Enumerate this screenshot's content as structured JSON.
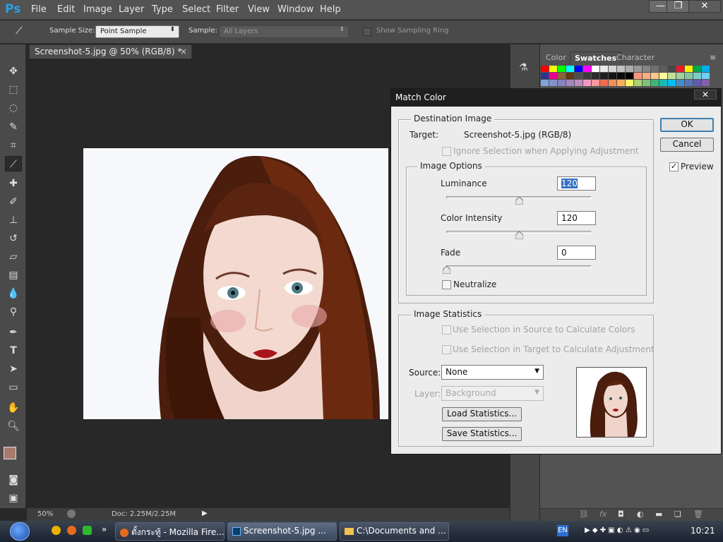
{
  "app": {
    "logo": "Ps",
    "menus": [
      "File",
      "Edit",
      "Image",
      "Layer",
      "Type",
      "Select",
      "Filter",
      "View",
      "Window",
      "Help"
    ],
    "window_controls": {
      "minimize": "—",
      "restore": "❐",
      "close": "✕"
    }
  },
  "options_bar": {
    "sample_size_label": "Sample Size:",
    "sample_size_value": "Point Sample",
    "sample_label": "Sample:",
    "sample_value": "All Layers",
    "show_ring_label": "Show Sampling Ring"
  },
  "document": {
    "tab_title": "Screenshot-5.jpg @ 50% (RGB/8) *",
    "tab_close": "×",
    "zoom": "50%",
    "doc_info": "Doc: 2.25M/2.25M"
  },
  "panels": {
    "tabs": [
      "Color",
      "Swatches",
      "Character"
    ],
    "active_tab": "Swatches",
    "swatch_row1": [
      "#ff0000",
      "#ffff00",
      "#00ff00",
      "#00ffff",
      "#0000ff",
      "#ff00ff",
      "#ffffff",
      "#ebebeb",
      "#d6d6d6",
      "#c2c2c2",
      "#adadad",
      "#999999",
      "#858585",
      "#707070",
      "#5c5c5c",
      "#474747",
      "#ed1c24",
      "#fff200",
      "#00a651",
      "#00aeef"
    ],
    "swatch_row2": [
      "#2e3192",
      "#ec008c",
      "#8c6239",
      "#603813",
      "#4d4d4d",
      "#3b3b3b",
      "#2b2b2b",
      "#1f1f1f",
      "#141414",
      "#0a0a0a",
      "#000000",
      "#f7977a",
      "#f9ad81",
      "#fdc68a",
      "#fff79a",
      "#c4df9b",
      "#a3d39c",
      "#82ca9d",
      "#7bcdc8",
      "#6ecff6"
    ],
    "swatch_row3": [
      "#7ea7d8",
      "#8493ca",
      "#8882be",
      "#a187be",
      "#bc8dbf",
      "#f49ac2",
      "#f6989d",
      "#f26c4f",
      "#f68e55",
      "#fbaf5c",
      "#fff467",
      "#acd372",
      "#7cc576",
      "#3bb878",
      "#1abbb4",
      "#00bff3",
      "#438ccb",
      "#5574b9",
      "#605ca8",
      "#855fa8"
    ]
  },
  "dialog": {
    "title": "Match Color",
    "close": "✕",
    "destination_group": "Destination Image",
    "target_label": "Target:",
    "target_value": "Screenshot-5.jpg (RGB/8)",
    "ignore_selection": "Ignore Selection when Applying Adjustment",
    "image_options_group": "Image Options",
    "luminance_label": "Luminance",
    "luminance_value": "120",
    "color_intensity_label": "Color Intensity",
    "color_intensity_value": "120",
    "fade_label": "Fade",
    "fade_value": "0",
    "neutralize_label": "Neutralize",
    "luminance_level": 0.5,
    "color_intensity_level": 0.5,
    "fade_level": 0,
    "image_statistics_group": "Image Statistics",
    "use_sel_source": "Use Selection in Source to Calculate Colors",
    "use_sel_target": "Use Selection in Target to Calculate Adjustment",
    "source_label": "Source:",
    "source_value": "None",
    "layer_label": "Layer:",
    "layer_value": "Background",
    "load_stats": "Load Statistics...",
    "save_stats": "Save Statistics...",
    "ok": "OK",
    "cancel": "Cancel",
    "preview_label": "Preview",
    "preview_checked": true
  },
  "taskbar": {
    "tasks": [
      "ตั้งกระทู้ - Mozilla Fire...",
      "Screenshot-5.jpg ...",
      "C:\\Documents and ..."
    ],
    "lang": "EN",
    "clock": "10:21"
  }
}
